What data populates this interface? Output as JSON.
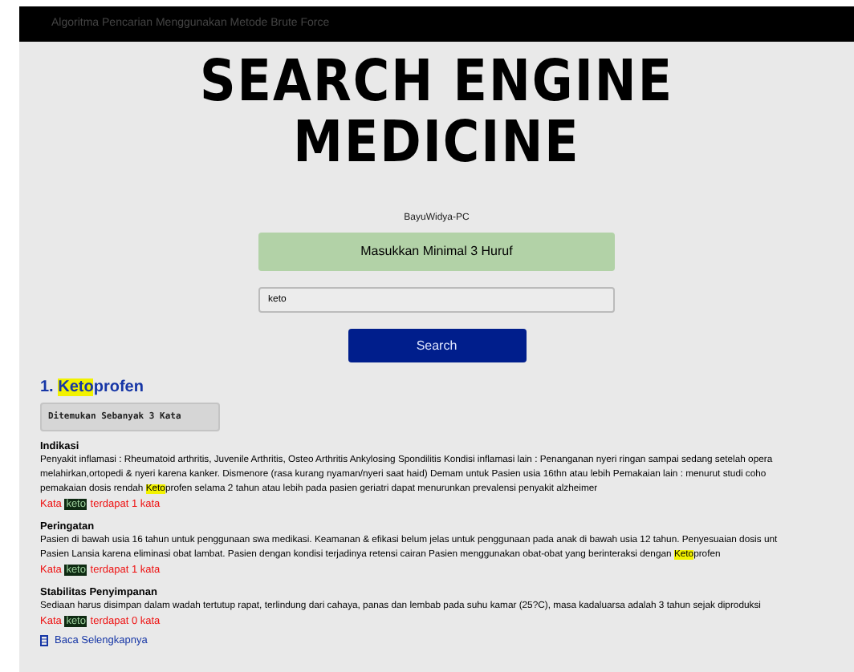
{
  "top_bar": {
    "title": "Algoritma Pencarian Menggunakan Metode Brute Force"
  },
  "logo": {
    "lines": [
      "SEARCH ENGINE",
      "MEDICINE"
    ]
  },
  "host": "BayuWidya-PC",
  "notice": "Masukkan Minimal 3 Huruf",
  "search": {
    "value": "keto",
    "button": "Search"
  },
  "results": [
    {
      "number": "1.",
      "title": [
        {
          "text": "Keto",
          "highlight": true
        },
        {
          "text": "profen",
          "highlight": false
        }
      ],
      "found": "Ditemukan Sebanyak 3 Kata",
      "sections": [
        {
          "heading": "Indikasi",
          "lines": [
            [
              {
                "text": "Penyakit inflamasi : Rheumatoid arthritis, Juvenile Arthritis, Osteo Arthritis Ankylosing Spondilitis Kondisi inflamasi lain : Penanganan nyeri ringan sampai sedang setelah opera",
                "highlight": false
              }
            ],
            [
              {
                "text": "melahirkan,ortopedi &  nyeri karena kanker. Dismenore (rasa kurang nyaman/nyeri saat haid) Demam untuk Pasien usia 16thn atau lebih Pemakaian lain : menurut studi coho",
                "highlight": false
              }
            ],
            [
              {
                "text": "pemakaian dosis rendah ",
                "highlight": false
              },
              {
                "text": "Keto",
                "highlight": true
              },
              {
                "text": "profen selama 2 tahun atau lebih pada pasien geriatri dapat menurunkan prevalensi penyakit alzheimer",
                "highlight": false
              }
            ]
          ],
          "count": {
            "before": "Kata",
            "keyword": "keto",
            "after": "terdapat 1 kata"
          }
        },
        {
          "heading": "Peringatan",
          "lines": [
            [
              {
                "text": "Pasien di bawah usia 16 tahun untuk penggunaan swa medikasi. Keamanan & efikasi belum jelas untuk penggunaan pada anak di bawah usia 12 tahun. Penyesuaian dosis unt",
                "highlight": false
              }
            ],
            [
              {
                "text": "Pasien Lansia karena eliminasi obat lambat. Pasien dengan kondisi terjadinya retensi cairan Pasien menggunakan obat-obat yang berinteraksi dengan ",
                "highlight": false
              },
              {
                "text": "Keto",
                "highlight": true
              },
              {
                "text": "profen",
                "highlight": false
              }
            ]
          ],
          "count": {
            "before": "Kata",
            "keyword": "keto",
            "after": "terdapat 1 kata"
          }
        },
        {
          "heading": "Stabilitas Penyimpanan",
          "lines": [
            [
              {
                "text": "Sediaan harus disimpan dalam wadah tertutup rapat, terlindung dari cahaya, panas dan lembab pada suhu kamar (25?C), masa kadaluarsa adalah 3 tahun sejak diproduksi",
                "highlight": false
              }
            ]
          ],
          "count": {
            "before": "Kata",
            "keyword": "keto",
            "after": "terdapat 0 kata"
          }
        }
      ],
      "more_link": "Baca Selengkapnya"
    }
  ]
}
